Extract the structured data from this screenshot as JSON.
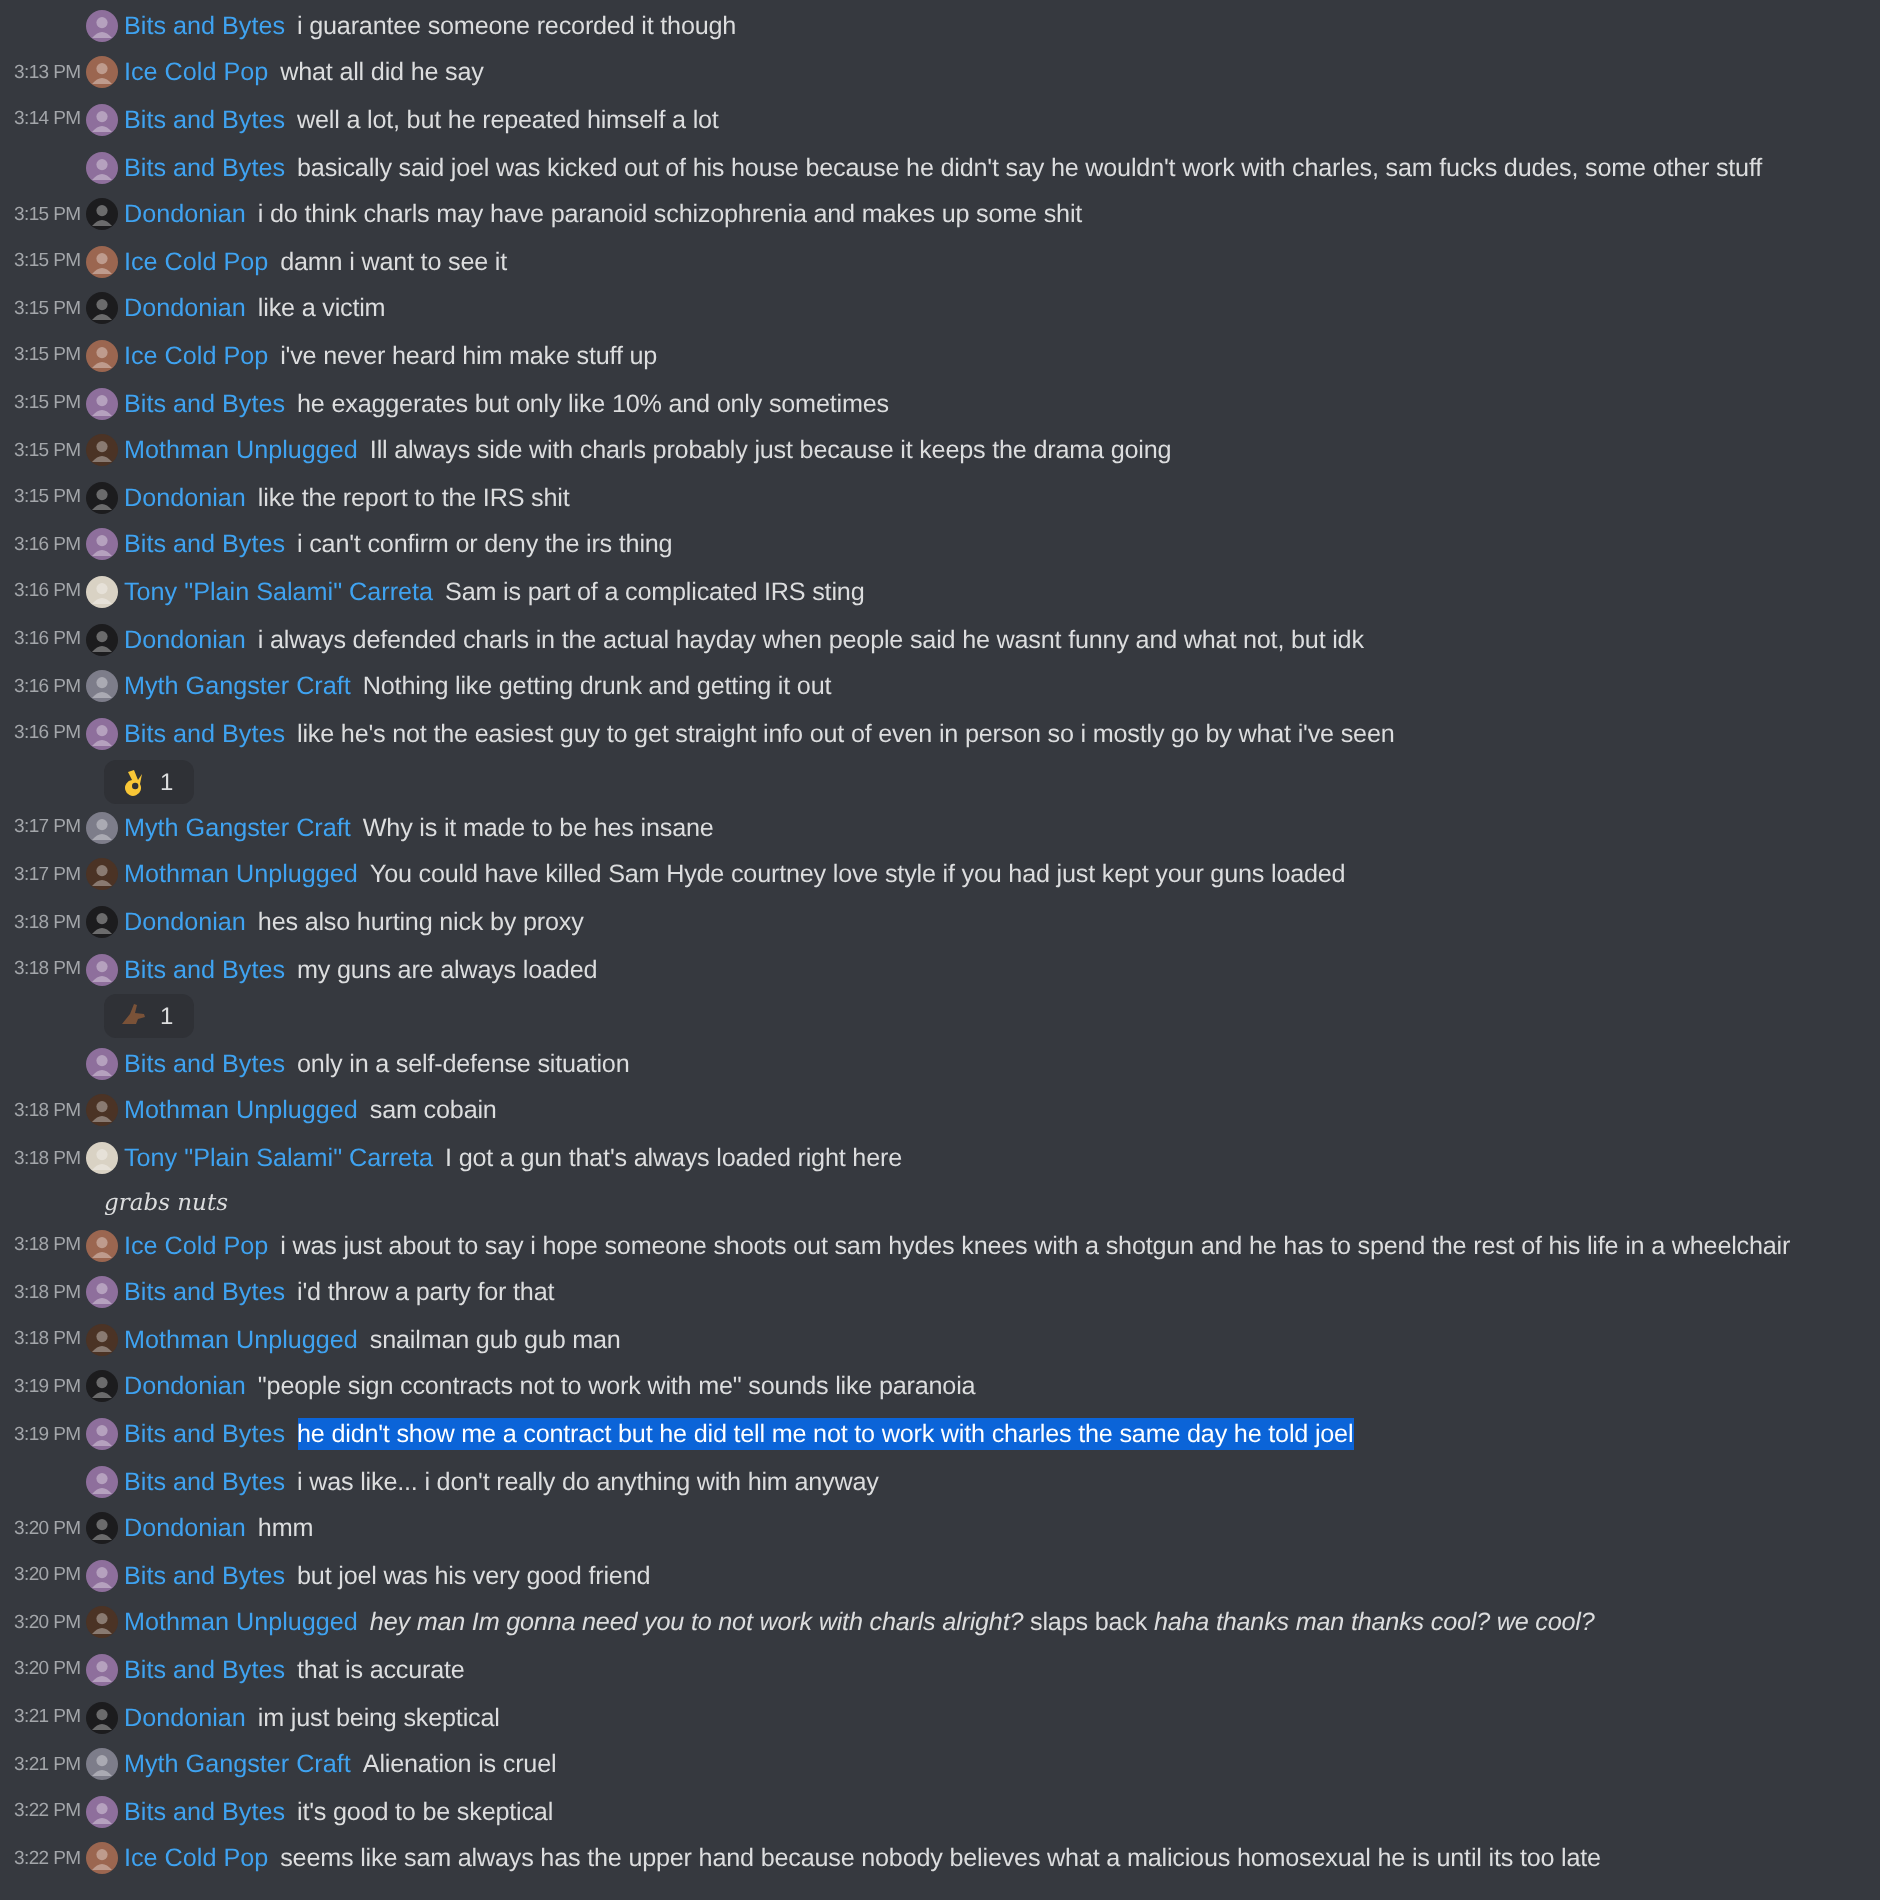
{
  "messages": [
    {
      "author": "Bits and Bytes",
      "color": "#8e6f9c",
      "text": "i guarantee someone recorded it though",
      "highlighted": false
    },
    {
      "time": "3:13 PM",
      "author": "Ice Cold Pop",
      "color": "#9b6650",
      "text": "what all did he say",
      "highlighted": false
    },
    {
      "time": "3:14 PM",
      "author": "Bits and Bytes",
      "color": "#8e6f9c",
      "text": "well a lot, but he repeated himself a lot",
      "highlighted": false
    },
    {
      "author": "Bits and Bytes",
      "color": "#8e6f9c",
      "text": "basically said joel was kicked out of his house because he didn't say he wouldn't work with charles, sam fucks dudes, some other stuff",
      "highlighted": false
    },
    {
      "time": "3:15 PM",
      "author": "Dondonian",
      "color": "#1c1c1e",
      "text": "i do think charls may have paranoid schizophrenia and makes up some shit",
      "highlighted": false
    },
    {
      "time": "3:15 PM",
      "author": "Ice Cold Pop",
      "color": "#9b6650",
      "text": "damn i want to see it",
      "highlighted": false
    },
    {
      "time": "3:15 PM",
      "author": "Dondonian",
      "color": "#1c1c1e",
      "text": "like a victim",
      "highlighted": false
    },
    {
      "time": "3:15 PM",
      "author": "Ice Cold Pop",
      "color": "#9b6650",
      "text": "i've never heard him make stuff up",
      "highlighted": false
    },
    {
      "time": "3:15 PM",
      "author": "Bits and Bytes",
      "color": "#8e6f9c",
      "text": "he exaggerates but only like 10% and only sometimes",
      "highlighted": false
    },
    {
      "time": "3:15 PM",
      "author": "Mothman Unplugged",
      "color": "#4b3325",
      "text": "Ill always side with charls probably just because it keeps the drama going",
      "highlighted": false
    },
    {
      "time": "3:15 PM",
      "author": "Dondonian",
      "color": "#1c1c1e",
      "text": "like the report to the IRS shit",
      "highlighted": false
    },
    {
      "time": "3:16 PM",
      "author": "Bits and Bytes",
      "color": "#8e6f9c",
      "text": "i can't confirm or deny the irs thing",
      "highlighted": false
    },
    {
      "time": "3:16 PM",
      "author": "Tony \"Plain Salami\" Carreta",
      "color": "#d9d2c4",
      "text": "Sam is part of a complicated IRS sting",
      "highlighted": false
    },
    {
      "time": "3:16 PM",
      "author": "Dondonian",
      "color": "#1c1c1e",
      "text": "i always defended charls in the actual hayday when people said he wasnt funny and what not, but idk",
      "highlighted": false
    },
    {
      "time": "3:16 PM",
      "author": "Myth Gangster Craft",
      "color": "#7d7d8a",
      "text": "Nothing like getting drunk and getting it out",
      "highlighted": false
    },
    {
      "time": "3:16 PM",
      "author": "Bits and Bytes",
      "color": "#8e6f9c",
      "text": "like he's not the easiest guy to get straight info out of even in person so i mostly go by what i've seen",
      "highlighted": false,
      "reaction": {
        "kind": "ok",
        "count": "1"
      }
    },
    {
      "time": "3:17 PM",
      "author": "Myth Gangster Craft",
      "color": "#7d7d8a",
      "text": "Why is it made to be hes insane",
      "highlighted": false
    },
    {
      "time": "3:17 PM",
      "author": "Mothman Unplugged",
      "color": "#4b3325",
      "text": "You could have killed Sam Hyde courtney love style if you had just kept your guns loaded",
      "highlighted": false
    },
    {
      "time": "3:18 PM",
      "author": "Dondonian",
      "color": "#1c1c1e",
      "text": "hes also hurting nick by proxy",
      "highlighted": false
    },
    {
      "time": "3:18 PM",
      "author": "Bits and Bytes",
      "color": "#8e6f9c",
      "text": "my guns are always loaded",
      "highlighted": false,
      "reaction": {
        "kind": "hand",
        "count": "1"
      }
    },
    {
      "author": "Bits and Bytes",
      "color": "#8e6f9c",
      "text": "only in a self-defense situation",
      "highlighted": false
    },
    {
      "time": "3:18 PM",
      "author": "Mothman Unplugged",
      "color": "#4b3325",
      "text": "sam cobain",
      "highlighted": false
    },
    {
      "time": "3:18 PM",
      "author": "Tony \"Plain Salami\" Carreta",
      "color": "#d9d2c4",
      "text": "I got a gun that's always loaded right here",
      "highlighted": false,
      "continuation": "grabs nuts"
    },
    {
      "time": "3:18 PM",
      "author": "Ice Cold Pop",
      "color": "#9b6650",
      "text": "i was just about to say i hope someone shoots out sam hydes knees with a shotgun and he has to spend the rest of his life in a wheelchair",
      "highlighted": false
    },
    {
      "time": "3:18 PM",
      "author": "Bits and Bytes",
      "color": "#8e6f9c",
      "text": "i'd throw a party for that",
      "highlighted": false
    },
    {
      "time": "3:18 PM",
      "author": "Mothman Unplugged",
      "color": "#4b3325",
      "text": "snailman gub gub man",
      "highlighted": false
    },
    {
      "time": "3:19 PM",
      "author": "Dondonian",
      "color": "#1c1c1e",
      "text": "\"people sign ccontracts not to work with me\" sounds like paranoia",
      "highlighted": false
    },
    {
      "time": "3:19 PM",
      "author": "Bits and Bytes",
      "color": "#8e6f9c",
      "text": "he didn't show me a contract but he did tell me not to work with charles the same day he told joel",
      "highlighted": true
    },
    {
      "author": "Bits and Bytes",
      "color": "#8e6f9c",
      "text": "i was like... i don't really do anything with him anyway",
      "highlighted": false
    },
    {
      "time": "3:20 PM",
      "author": "Dondonian",
      "color": "#1c1c1e",
      "text": "hmm",
      "highlighted": false
    },
    {
      "time": "3:20 PM",
      "author": "Bits and Bytes",
      "color": "#8e6f9c",
      "text": "but joel was his very good friend",
      "highlighted": false
    },
    {
      "time": "3:20 PM",
      "author": "Mothman Unplugged",
      "color": "#4b3325",
      "text": "*hey man Im gonna need you to not work with charls alright?* slaps back *haha thanks man thanks cool? we cool?*",
      "highlighted": false
    },
    {
      "time": "3:20 PM",
      "author": "Bits and Bytes",
      "color": "#8e6f9c",
      "text": "that is accurate",
      "highlighted": false
    },
    {
      "time": "3:21 PM",
      "author": "Dondonian",
      "color": "#1c1c1e",
      "text": "im just being skeptical",
      "highlighted": false
    },
    {
      "time": "3:21 PM",
      "author": "Myth Gangster Craft",
      "color": "#7d7d8a",
      "text": "Alienation is cruel",
      "highlighted": false
    },
    {
      "time": "3:22 PM",
      "author": "Bits and Bytes",
      "color": "#8e6f9c",
      "text": "it's good to be skeptical",
      "highlighted": false
    },
    {
      "time": "3:22 PM",
      "author": "Ice Cold Pop",
      "color": "#9b6650",
      "text": "seems like sam always has the upper hand because nobody believes what a malicious homosexual he is until its too late",
      "highlighted": false
    }
  ]
}
